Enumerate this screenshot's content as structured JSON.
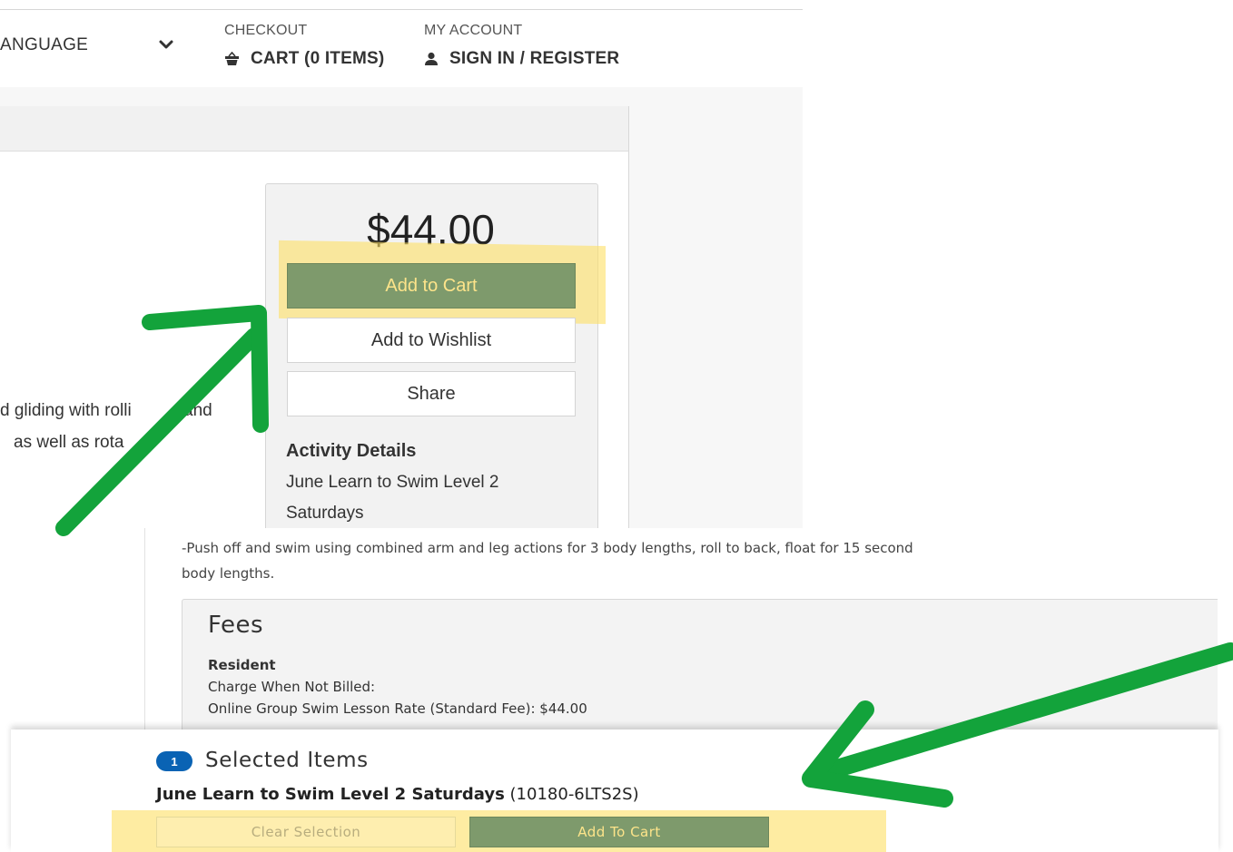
{
  "header": {
    "language_label": "ANGUAGE",
    "checkout_label": "CHECKOUT",
    "cart_label": "CART (0 ITEMS)",
    "account_label": "MY ACCOUNT",
    "signin_label": "SIGN IN / REGISTER"
  },
  "description": {
    "line1": "d gliding with rolli",
    "line1_tail": "and",
    "line2": "as well as rota"
  },
  "purchase_box": {
    "price": "$44.00",
    "add_to_cart_label": "Add to Cart",
    "add_to_wishlist_label": "Add to Wishlist",
    "share_label": "Share",
    "details_heading": "Activity Details",
    "details_line1": "June Learn to Swim Level 2",
    "details_line2": "Saturdays"
  },
  "body_text": {
    "line1": "-Push off and swim using combined arm and leg actions for 3 body lengths, roll to back, float for 15 second",
    "line2": "body lengths."
  },
  "fees": {
    "title": "Fees",
    "resident_label": "Resident",
    "charge_line": "Charge When Not Billed:",
    "rate_line": "Online Group Swim Lesson Rate (Standard Fee): $44.00"
  },
  "selected_items": {
    "count": "1",
    "title": "Selected Items",
    "item_name": "June Learn to Swim Level 2 Saturdays",
    "item_code": "(10180-6LTS2S)",
    "clear_label": "Clear Selection",
    "add_label": "Add To Cart"
  },
  "icons": {
    "chevron": "chevron-down-icon",
    "cart": "basket-icon",
    "user": "user-icon"
  },
  "colors": {
    "green_button": "#7e9a6c",
    "button_text": "#fde48a",
    "highlight": "#fde064",
    "badge_blue": "#0a63b4",
    "annotation_arrow": "#13a33b"
  }
}
